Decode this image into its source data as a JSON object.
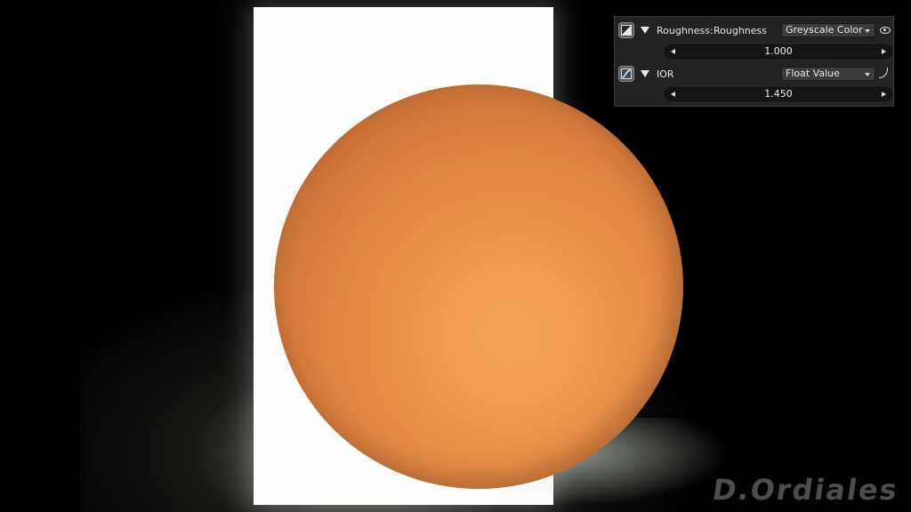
{
  "scene": {
    "watermark": "D.Ordiales",
    "sphere_color": "#ec954c",
    "backdrop_color": "#fdfdfd",
    "background_color": "#000000"
  },
  "panel": {
    "roughness": {
      "icon": "texture-slot-icon",
      "label": "Roughness:",
      "name": "Roughness",
      "type": "Greyscale Color",
      "value": "1.000",
      "toggle_icon": "eye-icon"
    },
    "ior": {
      "icon": "curve-slot-icon",
      "label": "IOR",
      "type": "Float Value",
      "value": "1.450",
      "toggle_icon": "curve-icon"
    }
  }
}
